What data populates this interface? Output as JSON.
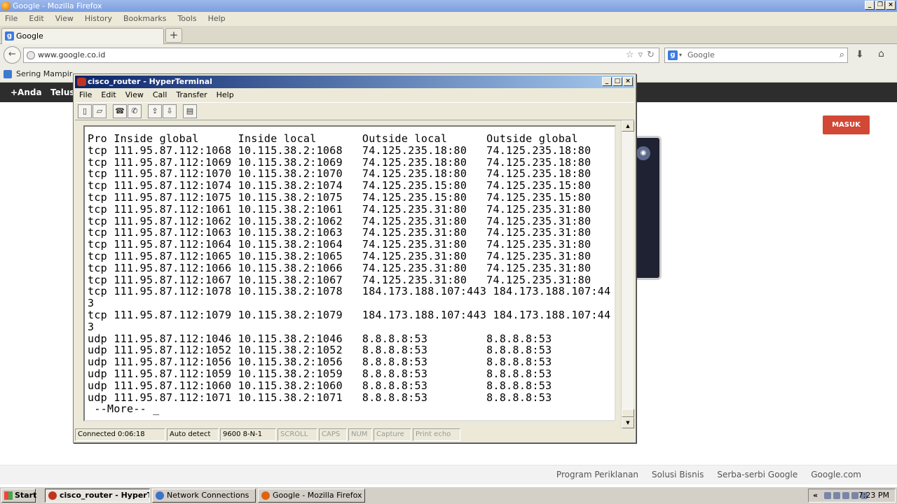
{
  "firefox": {
    "window_title": "Google - Mozilla Firefox",
    "menu": [
      "File",
      "Edit",
      "View",
      "History",
      "Bookmarks",
      "Tools",
      "Help"
    ],
    "tab_label": "Google",
    "new_tab": "+",
    "url": "www.google.co.id",
    "search_placeholder": "Google",
    "bookmark_label": "Sering Mampir"
  },
  "google": {
    "bar_anda": "+Anda",
    "bar_telusuri": "Telus",
    "masuk": "MASUK",
    "footer_links": [
      "Program Periklanan",
      "Solusi Bisnis",
      "Serba-serbi Google",
      "Google.com"
    ]
  },
  "hyperterminal": {
    "title": "cisco_router - HyperTerminal",
    "menu": [
      "File",
      "Edit",
      "View",
      "Call",
      "Transfer",
      "Help"
    ],
    "terminal_lines": [
      "Pro Inside global      Inside local       Outside local      Outside global",
      "tcp 111.95.87.112:1068 10.115.38.2:1068   74.125.235.18:80   74.125.235.18:80",
      "tcp 111.95.87.112:1069 10.115.38.2:1069   74.125.235.18:80   74.125.235.18:80",
      "tcp 111.95.87.112:1070 10.115.38.2:1070   74.125.235.18:80   74.125.235.18:80",
      "tcp 111.95.87.112:1074 10.115.38.2:1074   74.125.235.15:80   74.125.235.15:80",
      "tcp 111.95.87.112:1075 10.115.38.2:1075   74.125.235.15:80   74.125.235.15:80",
      "tcp 111.95.87.112:1061 10.115.38.2:1061   74.125.235.31:80   74.125.235.31:80",
      "tcp 111.95.87.112:1062 10.115.38.2:1062   74.125.235.31:80   74.125.235.31:80",
      "tcp 111.95.87.112:1063 10.115.38.2:1063   74.125.235.31:80   74.125.235.31:80",
      "tcp 111.95.87.112:1064 10.115.38.2:1064   74.125.235.31:80   74.125.235.31:80",
      "tcp 111.95.87.112:1065 10.115.38.2:1065   74.125.235.31:80   74.125.235.31:80",
      "tcp 111.95.87.112:1066 10.115.38.2:1066   74.125.235.31:80   74.125.235.31:80",
      "tcp 111.95.87.112:1067 10.115.38.2:1067   74.125.235.31:80   74.125.235.31:80",
      "tcp 111.95.87.112:1078 10.115.38.2:1078   184.173.188.107:443 184.173.188.107:44",
      "3",
      "tcp 111.95.87.112:1079 10.115.38.2:1079   184.173.188.107:443 184.173.188.107:44",
      "3",
      "udp 111.95.87.112:1046 10.115.38.2:1046   8.8.8.8:53         8.8.8.8:53",
      "udp 111.95.87.112:1052 10.115.38.2:1052   8.8.8.8:53         8.8.8.8:53",
      "udp 111.95.87.112:1056 10.115.38.2:1056   8.8.8.8:53         8.8.8.8:53",
      "udp 111.95.87.112:1059 10.115.38.2:1059   8.8.8.8:53         8.8.8.8:53",
      "udp 111.95.87.112:1060 10.115.38.2:1060   8.8.8.8:53         8.8.8.8:53",
      "udp 111.95.87.112:1071 10.115.38.2:1071   8.8.8.8:53         8.8.8.8:53",
      " --More-- _"
    ],
    "status": {
      "connected": "Connected 0:06:18",
      "detect": "Auto detect",
      "baud": "9600 8-N-1",
      "scroll": "SCROLL",
      "caps": "CAPS",
      "num": "NUM",
      "capture": "Capture",
      "print_echo": "Print echo"
    }
  },
  "taskbar": {
    "start": "Start",
    "tasks": [
      "cisco_router - HyperT...",
      "Network Connections",
      "Google - Mozilla Firefox"
    ],
    "tray_chevron": "«",
    "clock": "7:23 PM"
  },
  "colors": {
    "masuk_red": "#d14836",
    "google_bar": "#2d2d2d",
    "ht_title_start": "#0a246a",
    "ht_title_end": "#a6caf0"
  }
}
